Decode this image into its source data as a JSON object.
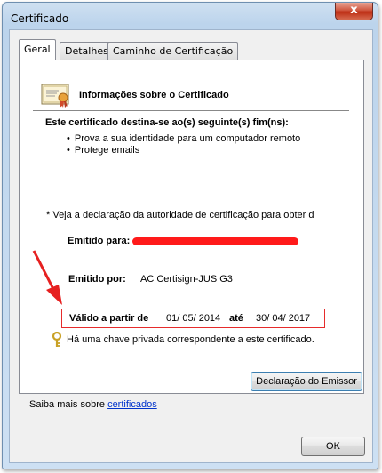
{
  "window": {
    "title": "Certificado",
    "close_label": "x"
  },
  "tabs": [
    {
      "label": "Geral",
      "active": true
    },
    {
      "label": "Detalhes",
      "active": false
    },
    {
      "label": "Caminho de Certificação",
      "active": false
    }
  ],
  "general": {
    "info_title": "Informações sobre o Certificado",
    "purpose_title": "Este certificado destina-se ao(s) seguinte(s) fim(ns):",
    "purposes": [
      "Prova a sua identidade para um computador remoto",
      "Protege emails"
    ],
    "note": "* Veja a declaração da autoridade de certificação para obter d",
    "issued_to_label": "Emitido para:",
    "issued_by_label": "Emitido por:",
    "issued_by_value": "AC Certisign-JUS G3",
    "valid_from_label": "Válido a partir de",
    "valid_from": "01/ 05/ 2014",
    "valid_until_label": "até",
    "valid_until": "30/ 04/ 2017",
    "private_key_note": "Há uma chave privada correspondente a este certificado.",
    "issuer_statement_button": "Declaração do Emissor"
  },
  "footer": {
    "learn_more_prefix": "Saiba mais sobre",
    "learn_more_link": "certificados",
    "ok_button": "OK"
  },
  "colors": {
    "highlight": "#e62b2b",
    "redaction": "#ff1a1a",
    "link": "#0033cc"
  },
  "icons": [
    "certificate-icon",
    "key-icon",
    "red-arrow-annotation"
  ]
}
